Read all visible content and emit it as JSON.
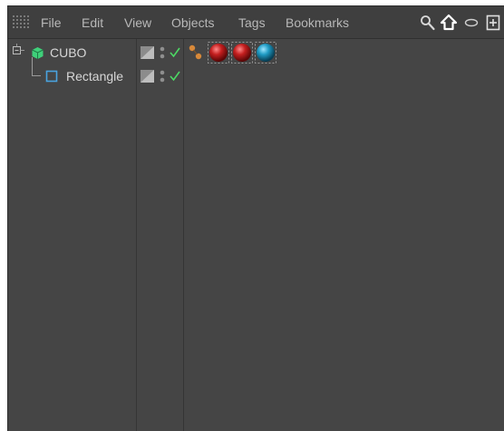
{
  "menu": {
    "items": [
      "File",
      "Edit",
      "View",
      "Objects",
      "Tags",
      "Bookmarks"
    ]
  },
  "toolbar": {
    "icons": [
      "search-icon",
      "home-icon",
      "ellipse-icon",
      "new-window-icon"
    ]
  },
  "objects": [
    {
      "name": "CUBO",
      "icon": "null-object-icon",
      "expanded": true,
      "icon_color": "#3fd07a"
    },
    {
      "name": "Rectangle",
      "icon": "rectangle-spline-icon",
      "icon_color": "#4aa3df"
    }
  ],
  "flags": {
    "layer_icon": "layer-swatch-icon",
    "visibility_icon": "visibility-dots-icon",
    "enabled_icon": "checkmark-icon",
    "enabled_color": "#4cd964"
  },
  "tags": [
    {
      "icon": "constraint-tag-icon",
      "color": "#d8893a"
    },
    {
      "icon": "material-tag-icon",
      "color": "#c41f1f"
    },
    {
      "icon": "material-tag-icon",
      "color": "#c41f1f"
    },
    {
      "icon": "material-tag-icon",
      "color": "#1f9bc4"
    }
  ],
  "colors": {
    "background": "#444444",
    "menubar": "#3f3f3f",
    "text": "#d7d7d7",
    "menu_text": "#b8b8b8"
  }
}
